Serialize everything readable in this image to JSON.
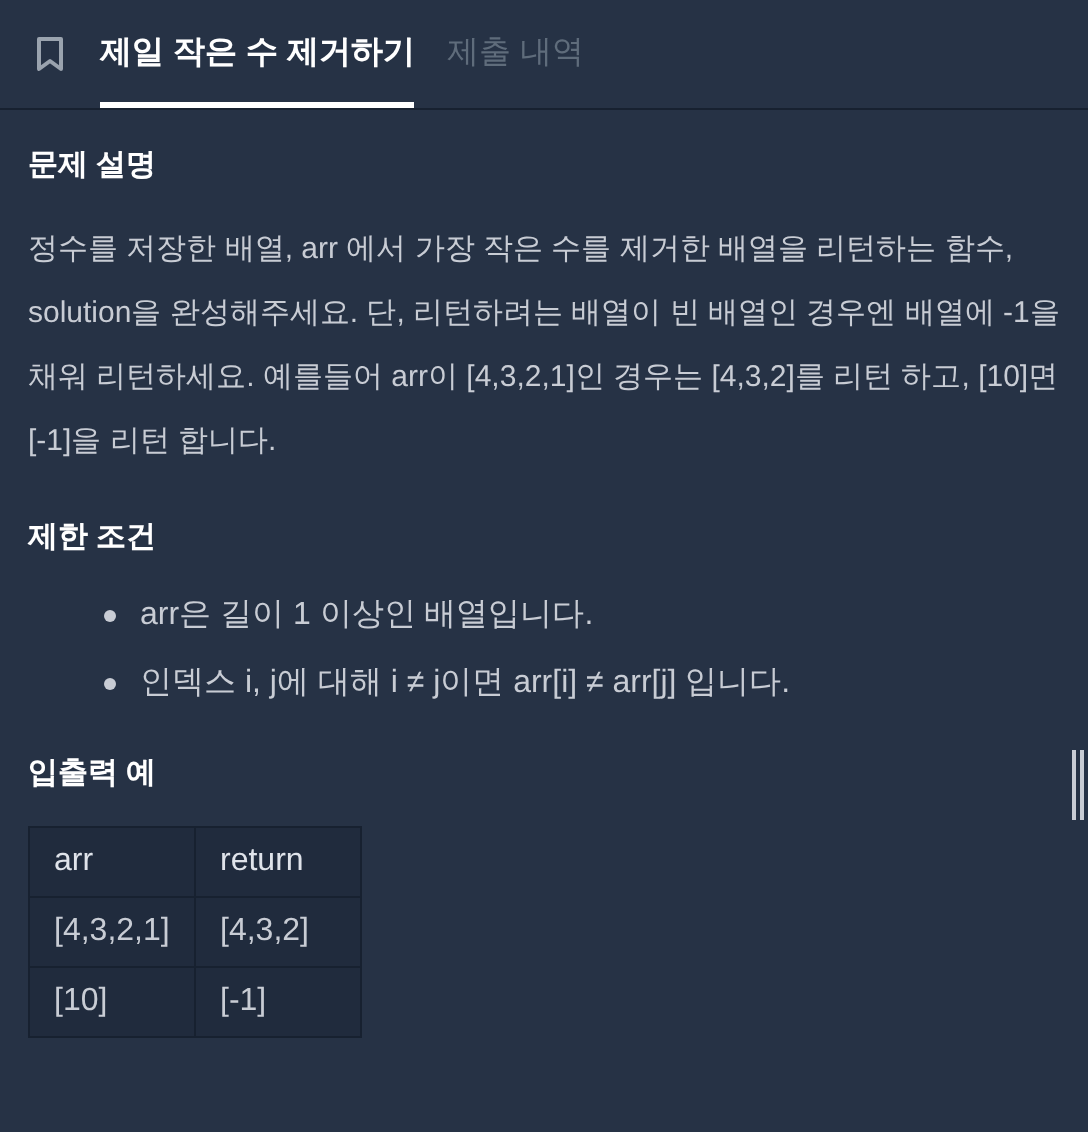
{
  "tabs": [
    {
      "label": "제일 작은 수 제거하기",
      "selected": true
    },
    {
      "label": "제출 내역",
      "selected": false
    }
  ],
  "sections": [
    {
      "heading": "문제 설명",
      "kind": "paragraph",
      "text": "정수를 저장한 배열, arr 에서 가장 작은 수를 제거한 배열을 리턴하는 함수, solution을 완성해주세요. 단, 리턴하려는 배열이 빈 배열인 경우엔 배열에 -1을 채워 리턴하세요. 예를들어 arr이 [4,3,2,1]인 경우는 [4,3,2]를 리턴 하고, [10]면 [-1]을 리턴 합니다."
    },
    {
      "heading": "제한 조건",
      "kind": "list",
      "items": [
        "arr은 길이 1 이상인 배열입니다.",
        "인덱스 i, j에 대해 i ≠ j이면 arr[i] ≠ arr[j] 입니다."
      ]
    },
    {
      "heading": "입출력 예",
      "kind": "table",
      "columns": [
        "arr",
        "return"
      ],
      "rows": [
        [
          "[4,3,2,1]",
          "[4,3,2]"
        ],
        [
          "[10]",
          "[-1]"
        ]
      ]
    }
  ]
}
